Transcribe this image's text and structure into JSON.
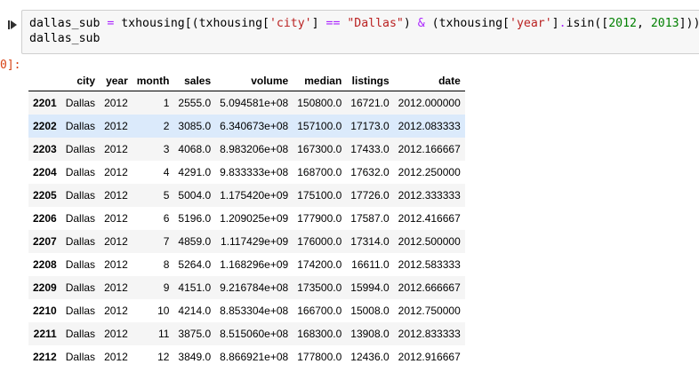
{
  "input_cell": {
    "code_line1_parts": [
      {
        "t": "dallas_sub ",
        "c": ""
      },
      {
        "t": "=",
        "c": "op"
      },
      {
        "t": " txhousing[(txhousing[",
        "c": ""
      },
      {
        "t": "'city'",
        "c": "str"
      },
      {
        "t": "] ",
        "c": ""
      },
      {
        "t": "==",
        "c": "op"
      },
      {
        "t": " ",
        "c": ""
      },
      {
        "t": "\"Dallas\"",
        "c": "str"
      },
      {
        "t": ") ",
        "c": ""
      },
      {
        "t": "&",
        "c": "op"
      },
      {
        "t": " (txhousing[",
        "c": ""
      },
      {
        "t": "'year'",
        "c": "str"
      },
      {
        "t": "]",
        "c": ""
      },
      {
        "t": ".",
        "c": "op"
      },
      {
        "t": "isin([",
        "c": ""
      },
      {
        "t": "2012",
        "c": "num"
      },
      {
        "t": ", ",
        "c": ""
      },
      {
        "t": "2013",
        "c": "num"
      },
      {
        "t": "]))]",
        "c": ""
      }
    ],
    "code_line2": "dallas_sub"
  },
  "output": {
    "prompt": "0]:",
    "columns": [
      "",
      "city",
      "year",
      "month",
      "sales",
      "volume",
      "median",
      "listings",
      "date"
    ],
    "rows": [
      [
        "2201",
        "Dallas",
        "2012",
        "1",
        "2555.0",
        "5.094581e+08",
        "150800.0",
        "16721.0",
        "2012.000000"
      ],
      [
        "2202",
        "Dallas",
        "2012",
        "2",
        "3085.0",
        "6.340673e+08",
        "157100.0",
        "17173.0",
        "2012.083333"
      ],
      [
        "2203",
        "Dallas",
        "2012",
        "3",
        "4068.0",
        "8.983206e+08",
        "167300.0",
        "17433.0",
        "2012.166667"
      ],
      [
        "2204",
        "Dallas",
        "2012",
        "4",
        "4291.0",
        "9.833333e+08",
        "168700.0",
        "17632.0",
        "2012.250000"
      ],
      [
        "2205",
        "Dallas",
        "2012",
        "5",
        "5004.0",
        "1.175420e+09",
        "175100.0",
        "17726.0",
        "2012.333333"
      ],
      [
        "2206",
        "Dallas",
        "2012",
        "6",
        "5196.0",
        "1.209025e+09",
        "177900.0",
        "17587.0",
        "2012.416667"
      ],
      [
        "2207",
        "Dallas",
        "2012",
        "7",
        "4859.0",
        "1.117429e+09",
        "176000.0",
        "17314.0",
        "2012.500000"
      ],
      [
        "2208",
        "Dallas",
        "2012",
        "8",
        "5264.0",
        "1.168296e+09",
        "174200.0",
        "16611.0",
        "2012.583333"
      ],
      [
        "2209",
        "Dallas",
        "2012",
        "9",
        "4151.0",
        "9.216784e+08",
        "173500.0",
        "15994.0",
        "2012.666667"
      ],
      [
        "2210",
        "Dallas",
        "2012",
        "10",
        "4214.0",
        "8.853304e+08",
        "166700.0",
        "15008.0",
        "2012.750000"
      ],
      [
        "2211",
        "Dallas",
        "2012",
        "11",
        "3875.0",
        "8.515060e+08",
        "168300.0",
        "13908.0",
        "2012.833333"
      ],
      [
        "2212",
        "Dallas",
        "2012",
        "12",
        "3849.0",
        "8.866921e+08",
        "177800.0",
        "12436.0",
        "2012.916667"
      ]
    ],
    "selected_row_index": 1
  },
  "colors": {
    "selected_row": "#dbeafb",
    "prompt": "#d84315",
    "code_bg": "#f7f7f7"
  }
}
